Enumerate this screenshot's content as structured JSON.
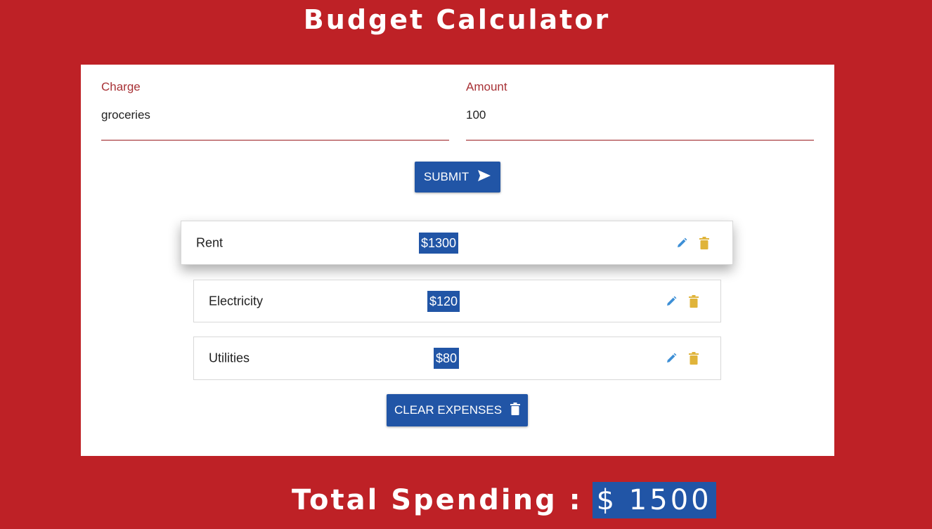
{
  "app": {
    "title": "Budget Calculator"
  },
  "form": {
    "charge": {
      "label": "Charge",
      "value": "groceries"
    },
    "amount": {
      "label": "Amount",
      "value": "100"
    },
    "submit_label": "SUBMIT"
  },
  "expenses": [
    {
      "name": "Rent",
      "amount": "$1300"
    },
    {
      "name": "Electricity",
      "amount": "$120"
    },
    {
      "name": "Utilities",
      "amount": "$80"
    }
  ],
  "clear_label": "CLEAR EXPENSES",
  "total": {
    "label": "Total Spending :",
    "value": "$ 1500"
  },
  "colors": {
    "background": "#be2126",
    "accent": "#2155a6",
    "edit_icon": "#3d8fd6",
    "delete_icon": "#e0b43a"
  },
  "icons": {
    "submit": "send-icon",
    "clear": "trash-icon",
    "edit": "pencil-icon",
    "delete": "trash-icon"
  }
}
